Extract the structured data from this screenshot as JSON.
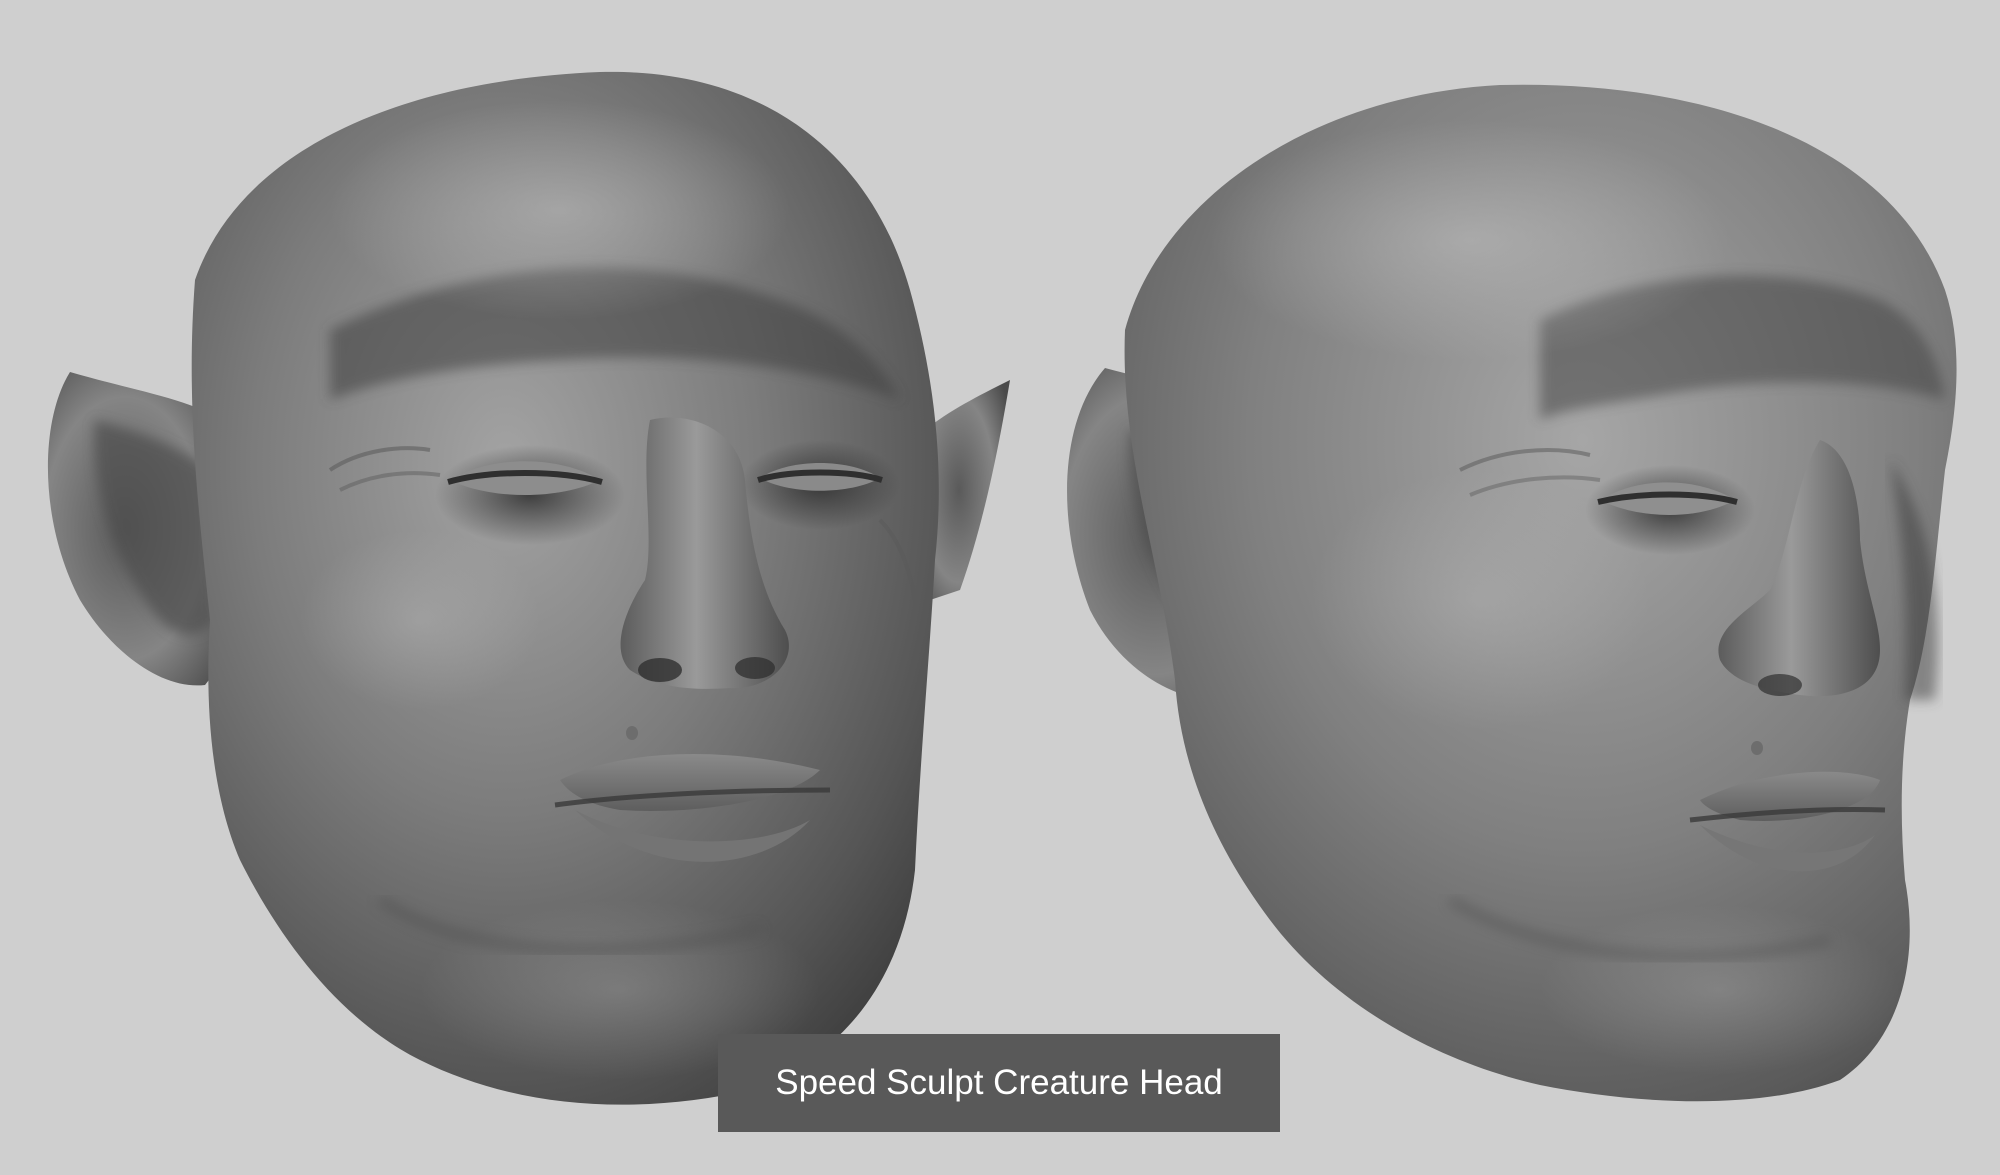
{
  "caption": {
    "text": "Speed Sculpt Creature Head"
  },
  "colors": {
    "background": "#cfcfcf",
    "sculpt_clay": "#7a7a7a",
    "caption_bar": "#595959",
    "caption_text": "#ffffff"
  },
  "renders": [
    {
      "view": "three-quarter-front",
      "subject": "creature-head-sculpt"
    },
    {
      "view": "three-quarter-side",
      "subject": "creature-head-sculpt"
    }
  ]
}
